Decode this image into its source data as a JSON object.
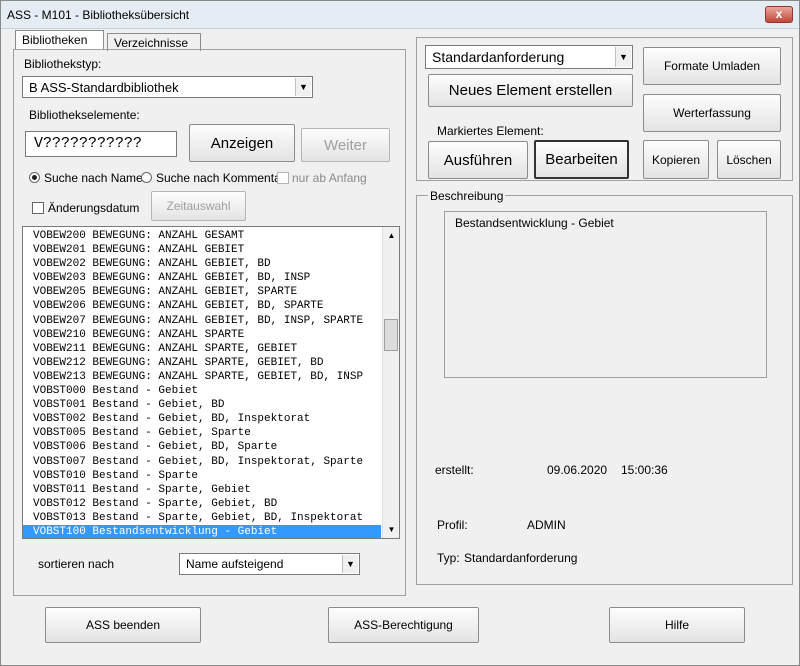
{
  "window": {
    "title": "ASS - M101 - Bibliotheksübersicht",
    "close": "x"
  },
  "tabs": [
    {
      "label": "Bibliotheken"
    },
    {
      "label": "Verzeichnisse"
    }
  ],
  "left": {
    "lib_type_label": "Bibliothekstyp:",
    "lib_type_value": "B    ASS-Standardbibliothek",
    "elements_label": "Bibliothekselemente:",
    "element_input_value": "V???????????",
    "show_button": "Anzeigen",
    "next_button": "Weiter",
    "radio_name": "Suche nach Name",
    "radio_comment": "Suche nach Kommentar",
    "check_from_start": "nur ab Anfang",
    "check_change_date": "Änderungsdatum",
    "time_select_button": "Zeitauswahl",
    "sort_label": "sortieren nach",
    "sort_value": "Name aufsteigend"
  },
  "list": {
    "rows": [
      "VOBEW200  BEWEGUNG: ANZAHL GESAMT",
      "VOBEW201  BEWEGUNG: ANZAHL GEBIET",
      "VOBEW202  BEWEGUNG: ANZAHL GEBIET, BD",
      "VOBEW203  BEWEGUNG: ANZAHL GEBIET, BD, INSP",
      "VOBEW205  BEWEGUNG: ANZAHL GEBIET, SPARTE",
      "VOBEW206  BEWEGUNG: ANZAHL GEBIET, BD, SPARTE",
      "VOBEW207  BEWEGUNG: ANZAHL GEBIET, BD, INSP, SPARTE",
      "VOBEW210  BEWEGUNG: ANZAHL SPARTE",
      "VOBEW211  BEWEGUNG: ANZAHL SPARTE, GEBIET",
      "VOBEW212  BEWEGUNG: ANZAHL SPARTE, GEBIET, BD",
      "VOBEW213  BEWEGUNG: ANZAHL SPARTE, GEBIET, BD, INSP",
      "VOBST000  Bestand - Gebiet",
      "VOBST001  Bestand - Gebiet, BD",
      "VOBST002  Bestand - Gebiet, BD, Inspektorat",
      "VOBST005  Bestand - Gebiet, Sparte",
      "VOBST006  Bestand - Gebiet, BD, Sparte",
      "VOBST007  Bestand - Gebiet, BD, Inspektorat, Sparte",
      "VOBST010  Bestand - Sparte",
      "VOBST011  Bestand - Sparte, Gebiet",
      "VOBST012  Bestand - Sparte, Gebiet, BD",
      "VOBST013  Bestand - Sparte, Gebiet, BD, Inspektorat",
      "VOBST100  Bestandsentwicklung - Gebiet"
    ],
    "selected_index": 21
  },
  "right": {
    "request_type_value": "Standardanforderung",
    "formats_button": "Formate Umladen",
    "new_element_button": "Neues Element erstellen",
    "value_capture_button": "Werterfassung",
    "marked_label": "Markiertes Element:",
    "execute_button": "Ausführen",
    "edit_button": "Bearbeiten",
    "copy_button": "Kopieren",
    "delete_button": "Löschen",
    "description_legend": "Beschreibung",
    "description_text": "Bestandsentwicklung - Gebiet",
    "created_label": "erstellt:",
    "created_date": "09.06.2020",
    "created_time": "15:00:36",
    "profile_label": "Profil:",
    "profile_value": "ADMIN",
    "type_label": "Typ:",
    "type_value": "Standardanforderung"
  },
  "footer": {
    "quit_button": "ASS beenden",
    "permission_button": "ASS-Berechtigung",
    "help_button": "Hilfe"
  }
}
